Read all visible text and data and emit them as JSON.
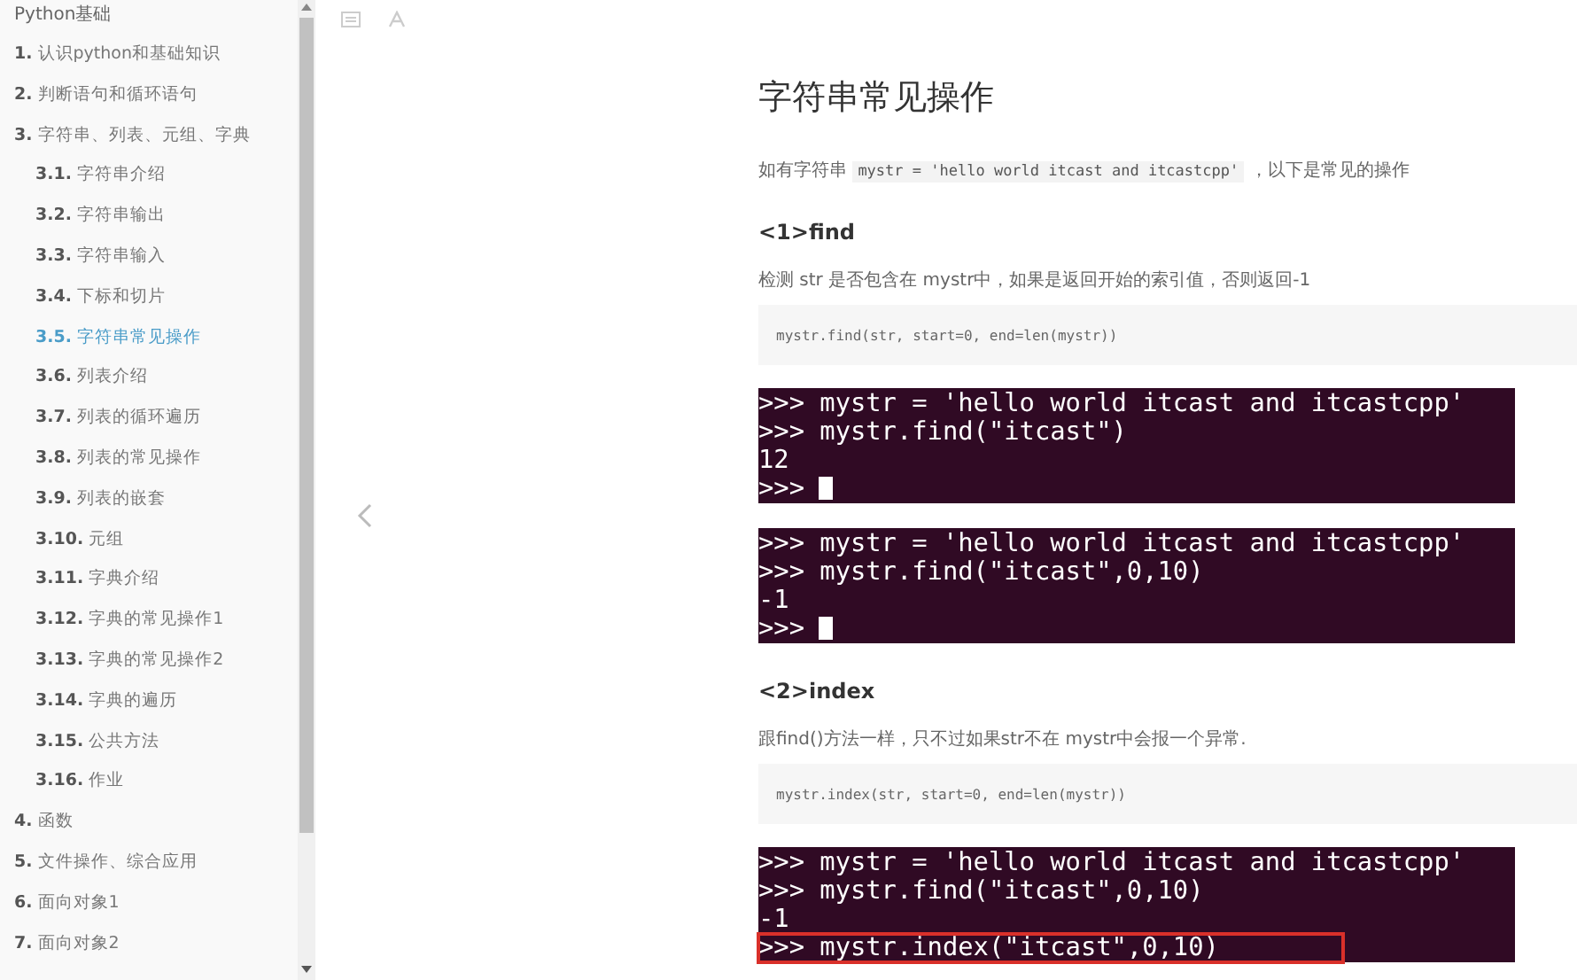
{
  "sidebar": {
    "title": "Python基础",
    "items": [
      {
        "number": "1.",
        "label": "认识python和基础知识",
        "selected": false
      },
      {
        "number": "2.",
        "label": "判断语句和循环语句",
        "selected": false
      },
      {
        "number": "3.",
        "label": "字符串、列表、元组、字典",
        "selected": false,
        "children": [
          {
            "number": "3.1.",
            "label": "字符串介绍",
            "selected": false
          },
          {
            "number": "3.2.",
            "label": "字符串输出",
            "selected": false
          },
          {
            "number": "3.3.",
            "label": "字符串输入",
            "selected": false
          },
          {
            "number": "3.4.",
            "label": "下标和切片",
            "selected": false
          },
          {
            "number": "3.5.",
            "label": "字符串常见操作",
            "selected": true
          },
          {
            "number": "3.6.",
            "label": "列表介绍",
            "selected": false
          },
          {
            "number": "3.7.",
            "label": "列表的循环遍历",
            "selected": false
          },
          {
            "number": "3.8.",
            "label": "列表的常见操作",
            "selected": false
          },
          {
            "number": "3.9.",
            "label": "列表的嵌套",
            "selected": false
          },
          {
            "number": "3.10.",
            "label": "元组",
            "selected": false
          },
          {
            "number": "3.11.",
            "label": "字典介绍",
            "selected": false
          },
          {
            "number": "3.12.",
            "label": "字典的常见操作1",
            "selected": false
          },
          {
            "number": "3.13.",
            "label": "字典的常见操作2",
            "selected": false
          },
          {
            "number": "3.14.",
            "label": "字典的遍历",
            "selected": false
          },
          {
            "number": "3.15.",
            "label": "公共方法",
            "selected": false
          },
          {
            "number": "3.16.",
            "label": "作业",
            "selected": false
          }
        ]
      },
      {
        "number": "4.",
        "label": "函数",
        "selected": false
      },
      {
        "number": "5.",
        "label": "文件操作、综合应用",
        "selected": false
      },
      {
        "number": "6.",
        "label": "面向对象1",
        "selected": false
      },
      {
        "number": "7.",
        "label": "面向对象2",
        "selected": false
      }
    ]
  },
  "article": {
    "title": "字符串常见操作",
    "intro": {
      "before": "如有字符串",
      "code": "mystr = 'hello world itcast and itcastcpp'",
      "after": "，以下是常见的操作"
    },
    "sections": [
      {
        "heading": "<1>find",
        "description": "检测 str 是否包含在 mystr中，如果是返回开始的索引值，否则返回-1",
        "signature": "mystr.find(str, start=0, end=len(mystr))",
        "terminals": [
          {
            "cursor": true,
            "lines": [
              {
                "text": ">>> mystr = 'hello world itcast and itcastcpp'",
                "highlighted": false
              },
              {
                "text": ">>> mystr.find(\"itcast\")",
                "highlighted": false
              },
              {
                "text": "12",
                "highlighted": false
              },
              {
                "text": ">>>",
                "highlighted": false
              }
            ]
          },
          {
            "cursor": true,
            "lines": [
              {
                "text": ">>> mystr = 'hello world itcast and itcastcpp'",
                "highlighted": false
              },
              {
                "text": ">>> mystr.find(\"itcast\",0,10)",
                "highlighted": false
              },
              {
                "text": "-1",
                "highlighted": false
              },
              {
                "text": ">>>",
                "highlighted": false
              }
            ]
          }
        ]
      },
      {
        "heading": "<2>index",
        "description": "跟find()方法一样，只不过如果str不在 mystr中会报一个异常.",
        "signature": "mystr.index(str, start=0, end=len(mystr))",
        "terminals": [
          {
            "cursor": false,
            "lines": [
              {
                "text": ">>> mystr = 'hello world itcast and itcastcpp'",
                "highlighted": false
              },
              {
                "text": ">>> mystr.find(\"itcast\",0,10)",
                "highlighted": false
              },
              {
                "text": "-1",
                "highlighted": false
              },
              {
                "text": ">>> mystr.index(\"itcast\",0,10)",
                "highlighted": true
              }
            ]
          }
        ]
      }
    ]
  }
}
